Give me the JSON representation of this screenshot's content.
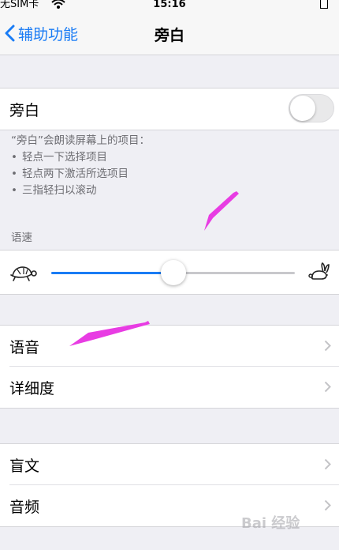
{
  "status_bar": {
    "carrier": "无SIM卡",
    "time": "15:16"
  },
  "nav": {
    "back_label": "辅助功能",
    "title": "旁白"
  },
  "voiceover": {
    "label": "旁白",
    "enabled": false
  },
  "footer": {
    "intro": "“旁白”会朗读屏幕上的项目：",
    "bullets": [
      "轻点一下选择项目",
      "轻点两下激活所选项目",
      "三指轻扫以滚动"
    ]
  },
  "speech_rate": {
    "header": "语速",
    "value_fraction": 0.5
  },
  "group_voice": [
    {
      "label": "语音"
    },
    {
      "label": "详细度"
    }
  ],
  "group_braille": [
    {
      "label": "盲文"
    },
    {
      "label": "音频"
    }
  ],
  "watermark": "Bai 经验",
  "colors": {
    "accent": "#1a7cf5",
    "annotation_arrow": "#e83ce3",
    "background": "#efeff4"
  }
}
